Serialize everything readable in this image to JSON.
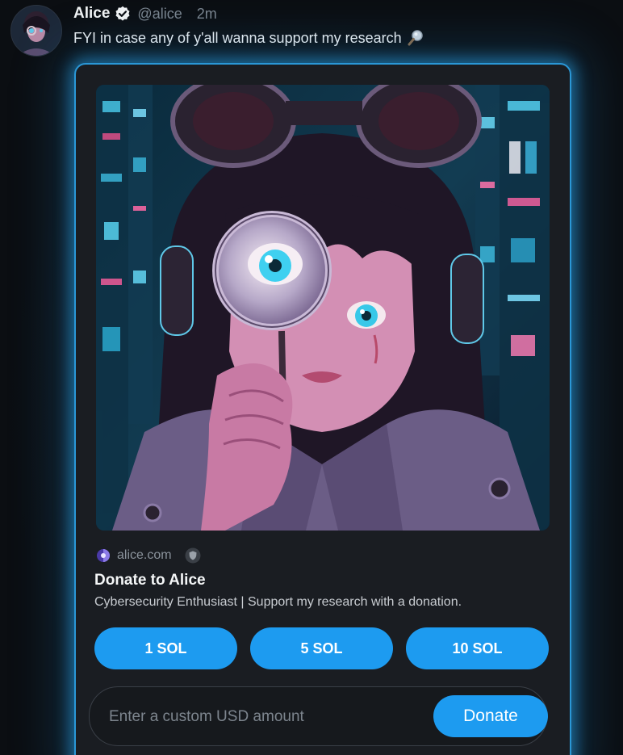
{
  "post": {
    "author_name": "Alice",
    "handle": "@alice",
    "time": "2m",
    "text": "FYI in case any of y'all wanna support my research",
    "emoji_icon": "magnifying-glass-icon"
  },
  "card": {
    "site": "alice.com",
    "title": "Donate to Alice",
    "description": "Cybersecurity Enthusiast | Support my research with a donation.",
    "amount_buttons": [
      "1 SOL",
      "5 SOL",
      "10 SOL"
    ],
    "custom_placeholder": "Enter a custom USD amount",
    "donate_label": "Donate"
  },
  "colors": {
    "accent": "#1d9bf0",
    "card_glow": "#2a97d6",
    "background": "#0b0e12"
  }
}
